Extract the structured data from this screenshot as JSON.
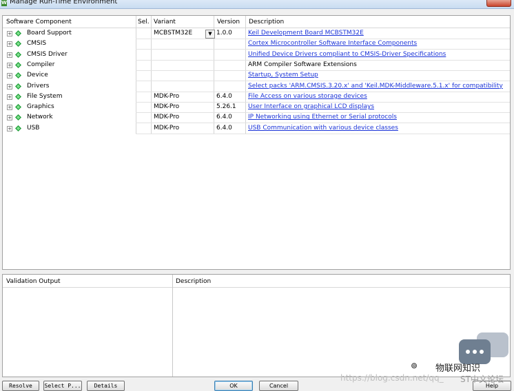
{
  "window": {
    "title": "Manage Run-Time Environment",
    "app_icon": "app-icon"
  },
  "grid": {
    "headers": {
      "component": "Software Component",
      "sel": "Sel.",
      "variant": "Variant",
      "version": "Version",
      "description": "Description"
    },
    "rows": [
      {
        "name": "Board Support",
        "variant": "MCBSTM32E",
        "version": "1.0.0",
        "description": "Keil Development Board MCBSTM32E",
        "link": true
      },
      {
        "name": "CMSIS",
        "variant": "",
        "version": "",
        "description": "Cortex Microcontroller Software Interface Components",
        "link": true
      },
      {
        "name": "CMSIS Driver",
        "variant": "",
        "version": "",
        "description": "Unified Device Drivers compliant to CMSIS-Driver Specifications",
        "link": true
      },
      {
        "name": "Compiler",
        "variant": "",
        "version": "",
        "description": "ARM Compiler Software Extensions",
        "link": false
      },
      {
        "name": "Device",
        "variant": "",
        "version": "",
        "description": "Startup, System Setup",
        "link": true
      },
      {
        "name": "Drivers",
        "variant": "",
        "version": "",
        "description": "Select packs 'ARM.CMSIS.3.20.x' and 'Keil.MDK-Middleware.5.1.x' for compatibility",
        "link": true
      },
      {
        "name": "File System",
        "variant": "MDK-Pro",
        "version": "6.4.0",
        "description": "File Access on various storage devices",
        "link": true
      },
      {
        "name": "Graphics",
        "variant": "MDK-Pro",
        "version": "5.26.1",
        "description": "User Interface on graphical LCD displays",
        "link": true
      },
      {
        "name": "Network",
        "variant": "MDK-Pro",
        "version": "6.4.0",
        "description": "IP Networking using Ethernet or Serial protocols",
        "link": true
      },
      {
        "name": "USB",
        "variant": "MDK-Pro",
        "version": "6.4.0",
        "description": "USB Communication with various device classes",
        "link": true
      }
    ]
  },
  "validation": {
    "output_header": "Validation Output",
    "description_header": "Description"
  },
  "buttons": {
    "resolve": "Resolve",
    "select_packs": "Select P...",
    "details": "Details",
    "ok": "OK",
    "cancel": "Cancel",
    "help": "Help"
  },
  "watermark": {
    "brand_text": "物联网知识",
    "url": "https://blog.csdn.net/qq_",
    "forum": "ST中文论坛"
  },
  "colors": {
    "link": "#1a33d8",
    "component_icon": "#1f9e3a",
    "panel_bg": "#f0f0f0"
  }
}
